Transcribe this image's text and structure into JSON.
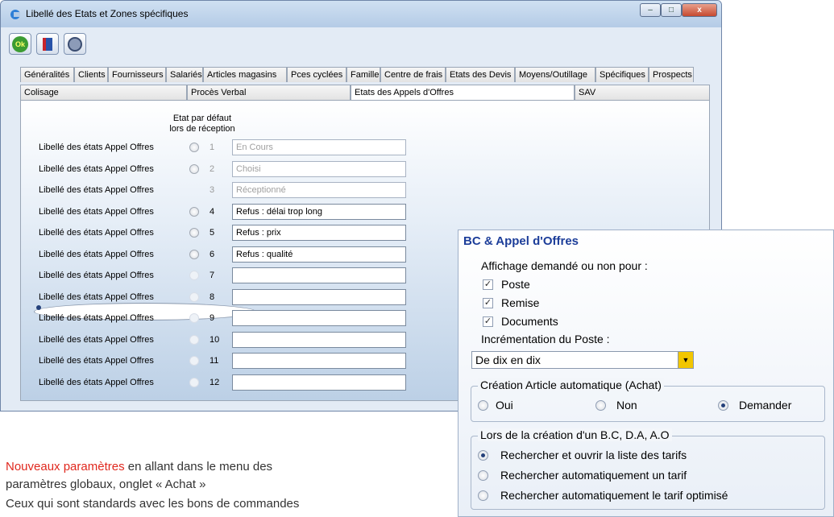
{
  "window": {
    "title": "Libellé des Etats et Zones spécifiques",
    "controls": {
      "minimize": "–",
      "maximize": "□",
      "close": "x"
    }
  },
  "toolbar": {
    "ok_label": "Ok"
  },
  "tabs_row1": [
    "Généralités",
    "Clients",
    "Fournisseurs",
    "Salariés",
    "Articles magasins",
    "Pces cyclées",
    "Famille",
    "Centre de frais",
    "Etats des Devis",
    "Moyens/Outillage",
    "Spécifiques",
    "Prospects"
  ],
  "tabs_row2": [
    "Colisage",
    "Procès Verbal",
    "Etats des Appels d'Offres",
    "SAV"
  ],
  "header": {
    "line1": "Etat par défaut",
    "line2": "lors de réception"
  },
  "rows": [
    {
      "label": "Libellé des états Appel Offres",
      "num": "1",
      "value": "En Cours",
      "selected": false,
      "radio_enabled": true,
      "dimmed": true
    },
    {
      "label": "Libellé des états Appel Offres",
      "num": "2",
      "value": "Choisi",
      "selected": false,
      "radio_enabled": true,
      "dimmed": true
    },
    {
      "label": "Libellé des états Appel Offres",
      "num": "3",
      "value": "Réceptionné",
      "selected": true,
      "radio_enabled": true,
      "dimmed": true
    },
    {
      "label": "Libellé des états Appel Offres",
      "num": "4",
      "value": "Refus : délai trop long",
      "selected": false,
      "radio_enabled": true,
      "dimmed": false
    },
    {
      "label": "Libellé des états Appel Offres",
      "num": "5",
      "value": "Refus : prix",
      "selected": false,
      "radio_enabled": true,
      "dimmed": false
    },
    {
      "label": "Libellé des états Appel Offres",
      "num": "6",
      "value": "Refus : qualité",
      "selected": false,
      "radio_enabled": true,
      "dimmed": false
    },
    {
      "label": "Libellé des états Appel Offres",
      "num": "7",
      "value": "",
      "selected": false,
      "radio_enabled": false,
      "dimmed": false
    },
    {
      "label": "Libellé des états Appel Offres",
      "num": "8",
      "value": "",
      "selected": false,
      "radio_enabled": false,
      "dimmed": false
    },
    {
      "label": "Libellé des états Appel Offres",
      "num": "9",
      "value": "",
      "selected": false,
      "radio_enabled": false,
      "dimmed": false
    },
    {
      "label": "Libellé des états Appel Offres",
      "num": "10",
      "value": "",
      "selected": false,
      "radio_enabled": false,
      "dimmed": false
    },
    {
      "label": "Libellé des états Appel Offres",
      "num": "11",
      "value": "",
      "selected": false,
      "radio_enabled": false,
      "dimmed": false
    },
    {
      "label": "Libellé des états Appel Offres",
      "num": "12",
      "value": "",
      "selected": false,
      "radio_enabled": false,
      "dimmed": false
    }
  ],
  "caption": {
    "highlight": "Nouveaux paramètres",
    "line1_rest": " en allant dans le menu des",
    "line2": "paramètres globaux, onglet « Achat »",
    "line3": "Ceux qui sont standards avec les bons de commandes"
  },
  "panel": {
    "title": "BC & Appel d'Offres",
    "display_label": "Affichage demandé ou non pour :",
    "checkboxes": [
      {
        "label": "Poste",
        "checked": true
      },
      {
        "label": "Remise",
        "checked": true
      },
      {
        "label": "Documents",
        "checked": true
      }
    ],
    "increment_label": "Incrémentation du Poste :",
    "increment_value": "De dix en dix",
    "creation_group": {
      "legend": "Création Article automatique (Achat)",
      "options": [
        "Oui",
        "Non",
        "Demander"
      ],
      "selected": "Demander"
    },
    "lors_group": {
      "legend": "Lors de la création d'un B.C, D.A, A.O",
      "options": [
        "Rechercher et ouvrir la liste des tarifs",
        "Rechercher automatiquement un tarif",
        "Rechercher automatiquement le tarif optimisé"
      ],
      "selected": "Rechercher et ouvrir la liste des tarifs"
    }
  },
  "colors": {
    "accent": "#1c3d99",
    "highlight": "#e0281e",
    "dropdown_button": "#f2c600"
  }
}
